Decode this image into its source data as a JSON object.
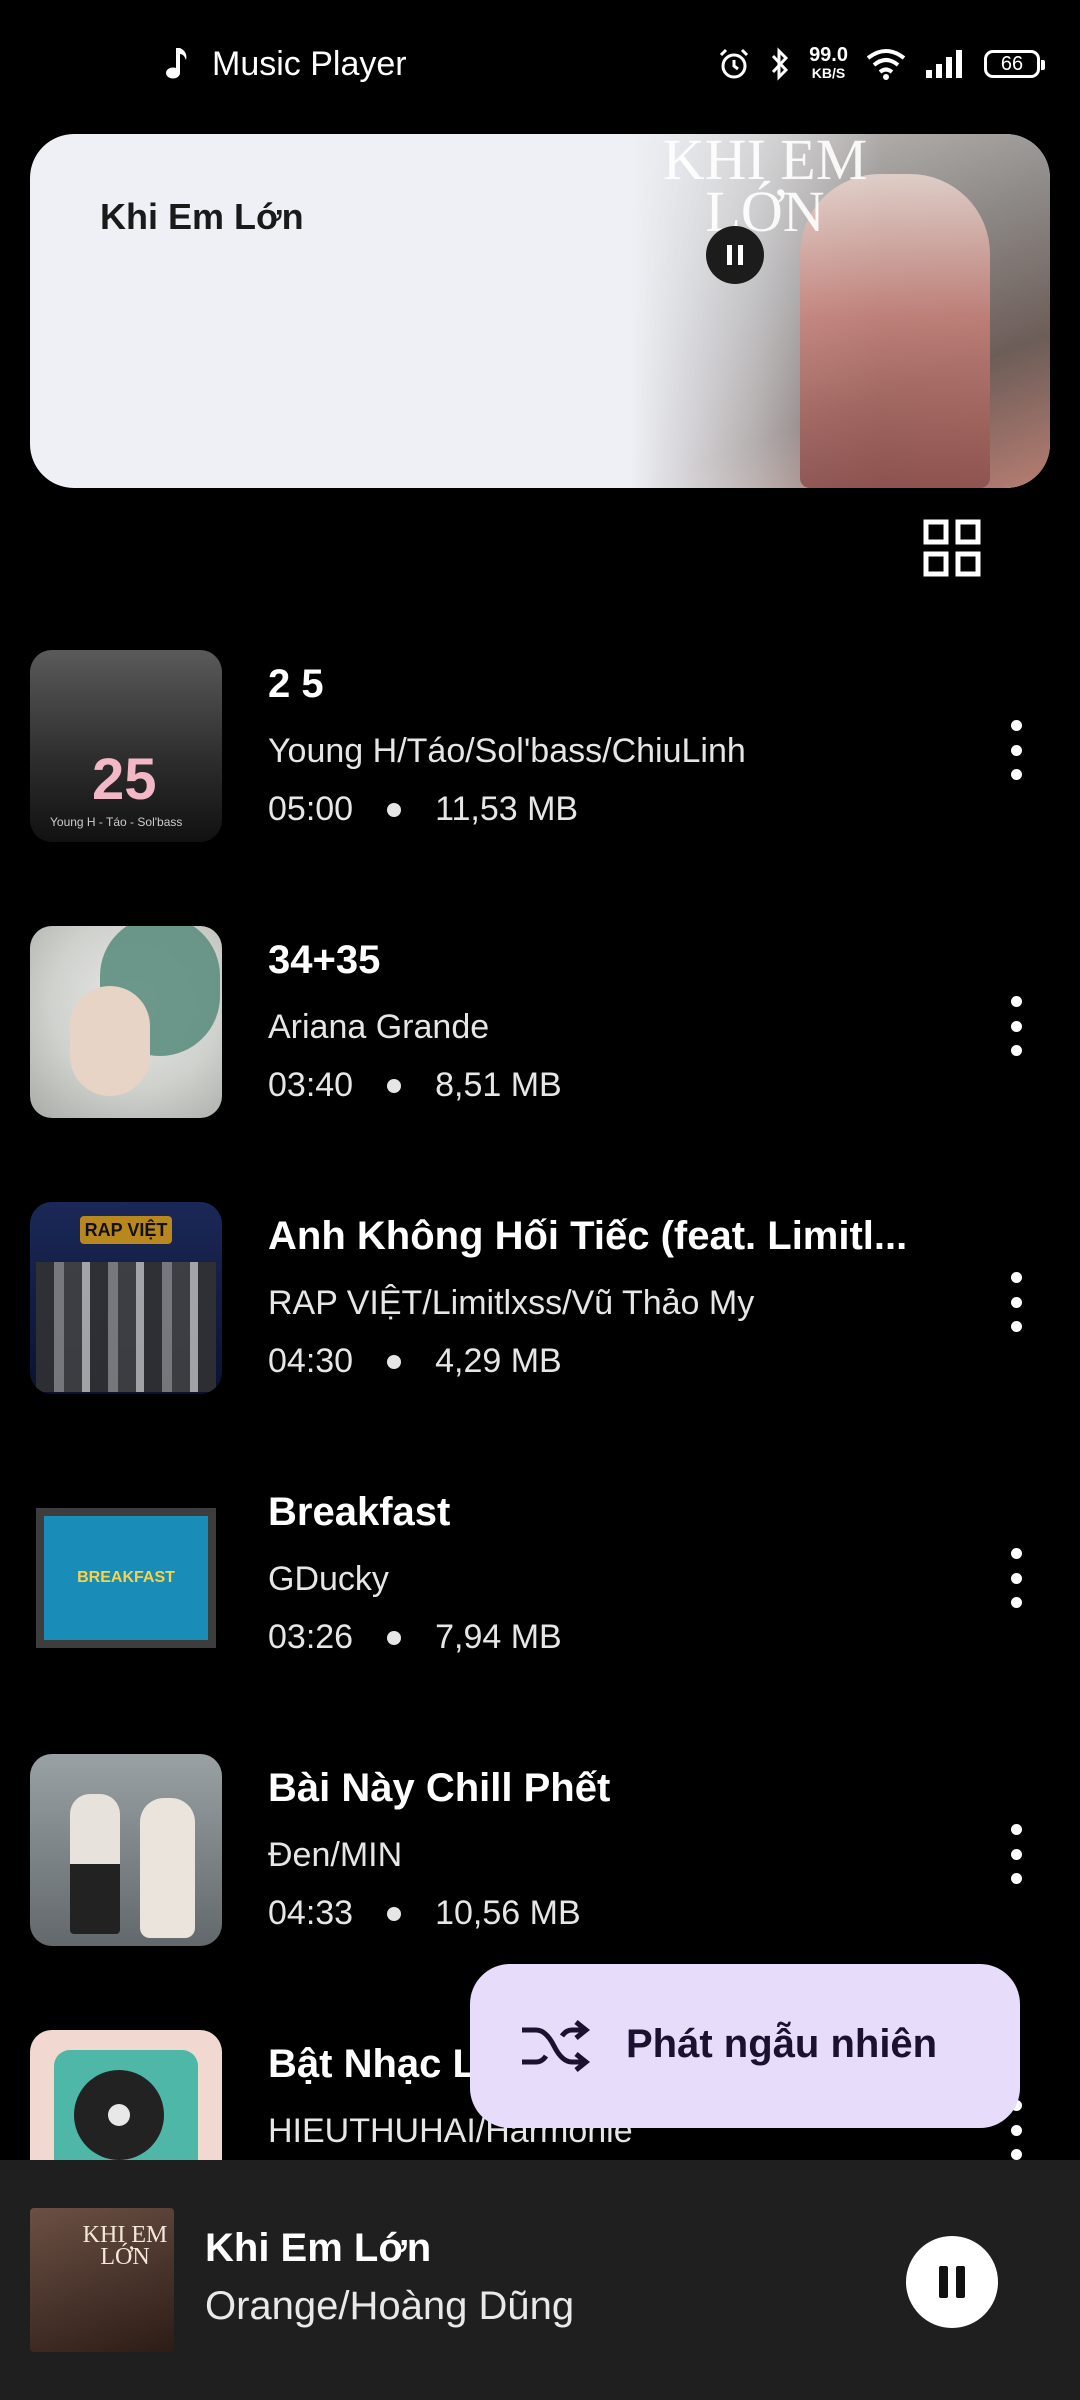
{
  "status_bar": {
    "app_title": "Music Player",
    "net_speed_value": "99.0",
    "net_speed_unit": "KB/S",
    "battery": "66"
  },
  "now_playing_card": {
    "title": "Khi Em Lớn",
    "art_text": "KHI EM LỚN"
  },
  "songs": [
    {
      "title": "2 5",
      "artist": "Young H/Táo/Sol'bass/ChiuLinh",
      "duration": "05:00",
      "size": "11,53 MB",
      "cover_text": "25",
      "cover_sub": "Young H - Táo - Sol'bass"
    },
    {
      "title": "34+35",
      "artist": "Ariana Grande",
      "duration": "03:40",
      "size": "8,51 MB"
    },
    {
      "title": "Anh Không Hối Tiếc (feat. Limitl...",
      "artist": "RAP VIỆT/Limitlxss/Vũ Thảo My",
      "duration": "04:30",
      "size": "4,29 MB",
      "cover_text": "RAP VIỆT"
    },
    {
      "title": "Breakfast",
      "artist": "GDucky",
      "duration": "03:26",
      "size": "7,94 MB",
      "cover_text": "BREAKFAST"
    },
    {
      "title": "Bài Này Chill Phết",
      "artist": "Đen/MIN",
      "duration": "04:33",
      "size": "10,56 MB"
    },
    {
      "title": "Bật Nhạc L",
      "artist": "HIEUTHUHAI/Harmonie",
      "duration": "",
      "size": ""
    }
  ],
  "shuffle_button": {
    "label": "Phát ngẫu nhiên"
  },
  "mini_player": {
    "title": "Khi Em Lớn",
    "artist": "Orange/Hoàng Dũng",
    "cover_text": "KHI EM LỚN"
  }
}
